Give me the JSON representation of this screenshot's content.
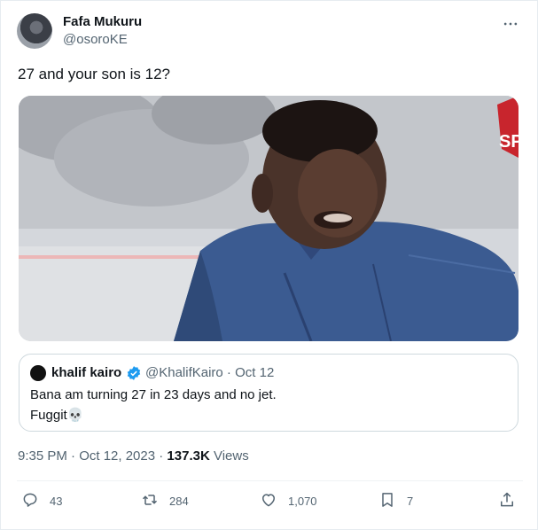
{
  "author": {
    "name": "Fafa Mukuru",
    "handle": "@osoroKE"
  },
  "tweet": {
    "text": "27 and your son is 12?"
  },
  "media": {
    "overlay_text": "SP"
  },
  "quoted_tweet": {
    "name": "khalif kairo",
    "handle_and_date": "@KhalifKairo · Oct 12",
    "line1": "Bana am turning 27 in 23 days and no jet.",
    "line2": "Fuggit",
    "emoji": "💀"
  },
  "meta": {
    "timestamp": "9:35 PM · Oct 12, 2023 · ",
    "views_count": "137.3K",
    "views_label": " Views"
  },
  "actions": {
    "replies": "43",
    "retweets": "284",
    "likes": "1,070",
    "bookmarks": "7"
  },
  "icons": {
    "more": "more-horizontal-icon",
    "verified": "verified-badge-icon",
    "reply": "reply-icon",
    "retweet": "retweet-icon",
    "like": "heart-icon",
    "bookmark": "bookmark-icon",
    "share": "share-icon"
  },
  "colors": {
    "text": "#0f1419",
    "secondary": "#536471",
    "verified": "#1d9bf0",
    "border": "#cfd9de"
  }
}
